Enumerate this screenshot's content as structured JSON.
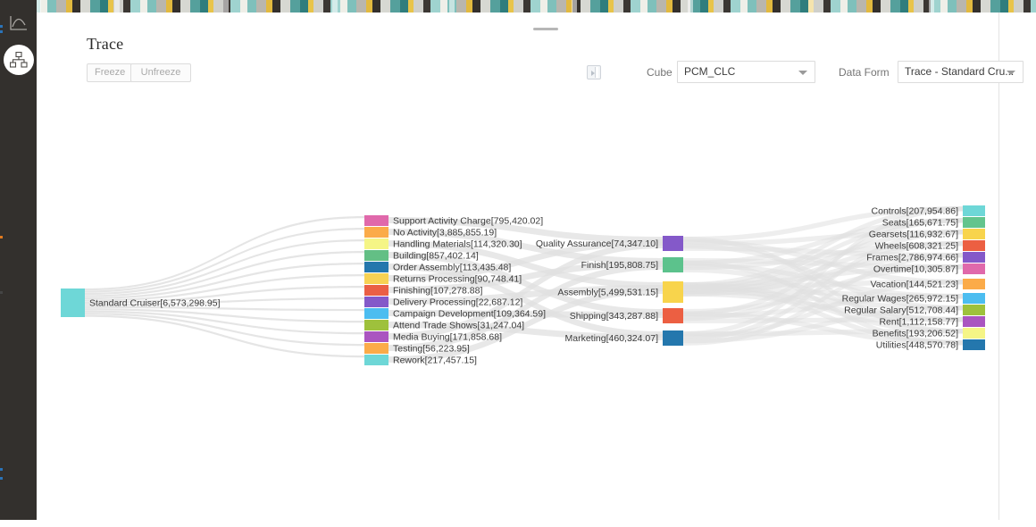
{
  "window": {
    "title": "Trace"
  },
  "sidebar": {
    "items": [
      {
        "name": "analytics-icon",
        "label": "Analytics"
      },
      {
        "name": "hierarchy-icon",
        "label": "Model"
      }
    ]
  },
  "toolbar": {
    "freeze_label": "Freeze",
    "unfreeze_label": "Unfreeze",
    "panel_toggle_label": "Expand Panel",
    "cube_label": "Cube",
    "cube_value": "PCM_CLC",
    "data_form_label": "Data Form",
    "data_form_value": "Trace - Standard Cru...",
    "more_label": "More options"
  },
  "chart_data": {
    "type": "sankey",
    "title": "Trace - Standard Cruiser",
    "link_color": "#e0e0e0",
    "columns": [
      {
        "name": "source",
        "nodes": [
          {
            "label": "Standard Cruiser[6,573,298.95]",
            "value": 6573298.95,
            "color": "#6ed7d7"
          }
        ]
      },
      {
        "name": "activities",
        "nodes": [
          {
            "label": "Support Activity Charge[795,420.02]",
            "value": 795420.02,
            "color": "#e069ab"
          },
          {
            "label": "No Activity[3,885,855.19]",
            "value": 3885855.19,
            "color": "#fbab49"
          },
          {
            "label": "Handling Materials[114,320.30]",
            "value": 114320.3,
            "color": "#f5f586"
          },
          {
            "label": "Building[857,402.14]",
            "value": 857402.14,
            "color": "#63bf85"
          },
          {
            "label": "Order Assembly[113,435.48]",
            "value": 113435.48,
            "color": "#2477ad"
          },
          {
            "label": "Returns Processing[90,748.41]",
            "value": 90748.41,
            "color": "#f7d254"
          },
          {
            "label": "Finishing[107,278.88]",
            "value": 107278.88,
            "color": "#ea5f45"
          },
          {
            "label": "Delivery Processing[22,687.12]",
            "value": 22687.12,
            "color": "#8459c9"
          },
          {
            "label": "Campaign Development[109,364.59]",
            "value": 109364.59,
            "color": "#4cbdf0"
          },
          {
            "label": "Attend Trade Shows[31,247.04]",
            "value": 31247.04,
            "color": "#9ec13c"
          },
          {
            "label": "Media Buying[171,858.68]",
            "value": 171858.68,
            "color": "#aa55c0"
          },
          {
            "label": "Testing[56,223.95]",
            "value": 56223.95,
            "color": "#fbab49"
          },
          {
            "label": "Rework[217,457.15]",
            "value": 217457.15,
            "color": "#6ed7d7"
          }
        ]
      },
      {
        "name": "processes",
        "nodes": [
          {
            "label": "Quality Assurance[74,347.10]",
            "value": 74347.1,
            "color": "#8459c9"
          },
          {
            "label": "Finish[195,808.75]",
            "value": 195808.75,
            "color": "#5cc28c"
          },
          {
            "label": "Assembly[5,499,531.15]",
            "value": 5499531.15,
            "color": "#f8d44c"
          },
          {
            "label": "Shipping[343,287.88]",
            "value": 343287.88,
            "color": "#ec5f42"
          },
          {
            "label": "Marketing[460,324.07]",
            "value": 460324.07,
            "color": "#2477ad"
          }
        ]
      },
      {
        "name": "resources",
        "nodes": [
          {
            "label": "Controls[207,954.86]",
            "value": 207954.86,
            "color": "#6ed7d7"
          },
          {
            "label": "Seats[165,671.75]",
            "value": 165671.75,
            "color": "#63c48d"
          },
          {
            "label": "Gearsets[116,932.67]",
            "value": 116932.67,
            "color": "#f8d44c"
          },
          {
            "label": "Wheels[608,321.25]",
            "value": 608321.25,
            "color": "#ec5f42"
          },
          {
            "label": "Frames[2,786,974.66]",
            "value": 2786974.66,
            "color": "#8459c9"
          },
          {
            "label": "Overtime[10,305.87]",
            "value": 10305.87,
            "color": "#e069ab"
          },
          {
            "label": "Vacation[144,521.23]",
            "value": 144521.23,
            "color": "#fbab49"
          },
          {
            "label": "Regular Wages[265,972.15]",
            "value": 265972.15,
            "color": "#4cbdf0"
          },
          {
            "label": "Regular Salary[512,708.44]",
            "value": 512708.44,
            "color": "#9ec13c"
          },
          {
            "label": "Rent[1,112,158.77]",
            "value": 1112158.77,
            "color": "#aa55c0"
          },
          {
            "label": "Benefits[193,206.52]",
            "value": 193206.52,
            "color": "#f5f586"
          },
          {
            "label": "Utilities[448,570.78]",
            "value": 448570.78,
            "color": "#2477ad"
          }
        ]
      }
    ]
  }
}
